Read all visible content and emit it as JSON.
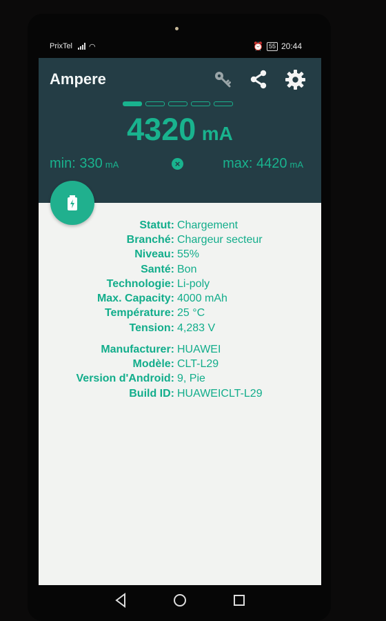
{
  "status_bar": {
    "carrier": "PrixTel",
    "battery_level": "55",
    "time": "20:44"
  },
  "header": {
    "title": "Ampere",
    "icons": [
      "key-icon",
      "share-icon",
      "gear-icon"
    ]
  },
  "pager": {
    "active_index": 0,
    "count": 5
  },
  "reading": {
    "current_value": "4320",
    "current_unit": "mA",
    "min_label": "min:",
    "min_value": "330",
    "min_unit": "mA",
    "max_label": "max:",
    "max_value": "4420",
    "max_unit": "mA"
  },
  "battery_info": [
    {
      "label": "Statut:",
      "value": "Chargement"
    },
    {
      "label": "Branché:",
      "value": "Chargeur secteur"
    },
    {
      "label": "Niveau:",
      "value": "55%"
    },
    {
      "label": "Santé:",
      "value": "Bon"
    },
    {
      "label": "Technologie:",
      "value": "Li-poly"
    },
    {
      "label": "Max. Capacity:",
      "value": "4000 mAh"
    },
    {
      "label": "Température:",
      "value": "25 °C"
    },
    {
      "label": "Tension:",
      "value": "4,283 V"
    }
  ],
  "device_info": [
    {
      "label": "Manufacturer:",
      "value": "HUAWEI"
    },
    {
      "label": "Modèle:",
      "value": "CLT-L29"
    },
    {
      "label": "Version d'Android:",
      "value": "9, Pie"
    },
    {
      "label": "Build ID:",
      "value": "HUAWEICLT-L29"
    }
  ],
  "colors": {
    "header_bg": "#243d45",
    "accent": "#19b38e",
    "content_bg": "#f2f3f1"
  }
}
